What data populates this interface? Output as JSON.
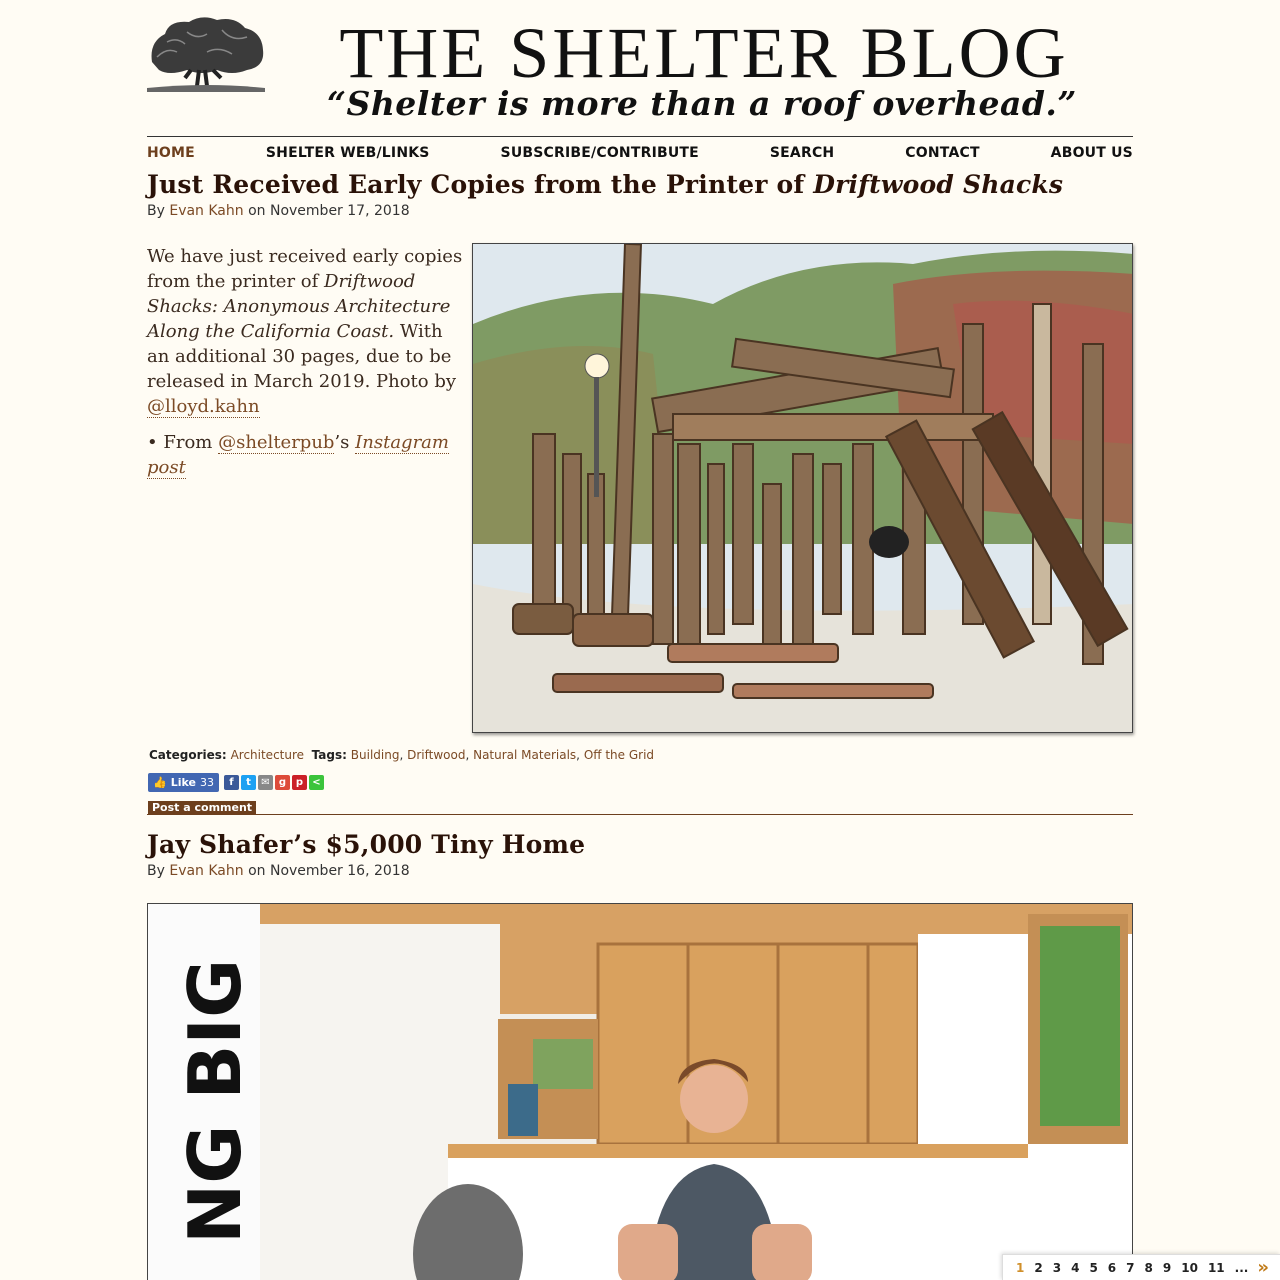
{
  "site": {
    "title": "THE SHELTER BLOG",
    "tagline": "“Shelter is more than a roof overhead.”"
  },
  "nav": {
    "items": [
      "HOME",
      "SHELTER WEB/LINKS",
      "SUBSCRIBE/CONTRIBUTE",
      "SEARCH",
      "CONTACT",
      "ABOUT US"
    ],
    "active": "HOME"
  },
  "post1": {
    "title_prefix": "Just Received Early Copies from the Printer of ",
    "title_em": "Driftwood Shacks",
    "by": "By",
    "author": "Evan Kahn",
    "on": "on November 17, 2018",
    "body_1": "We have just received early copies from the printer of ",
    "body_em": "Driftwood Shacks: Anonymous Architecture Along the California Coast.",
    "body_2": " With an additional 30 pages, due to be released in March 2019. Photo by ",
    "body_link": "@lloyd.kahn",
    "bullet_pre": "From ",
    "bullet_link": "@shelterpub",
    "bullet_mid": "’s ",
    "bullet_em_link": "Instagram post",
    "categories_label": "Categories:",
    "categories": "Architecture",
    "tags_label": "Tags:",
    "tags": [
      "Building",
      "Driftwood",
      "Natural Materials",
      "Off the Grid"
    ],
    "like_label": "Like",
    "like_count": "33",
    "comment_label": "Post a comment"
  },
  "post2": {
    "title": "Jay Shafer’s $5,000 Tiny Home",
    "by": "By",
    "author": "Evan Kahn",
    "on": "on November 16, 2018",
    "image_text": "NG BIG"
  },
  "pager": {
    "pages": [
      "1",
      "2",
      "3",
      "4",
      "5",
      "6",
      "7",
      "8",
      "9",
      "10",
      "11",
      "..."
    ],
    "current": "1",
    "next": "»"
  },
  "colors": {
    "background": "#fffcf4",
    "link": "#7b4a25",
    "title": "#2a1208",
    "accent": "#6d3f1d"
  }
}
